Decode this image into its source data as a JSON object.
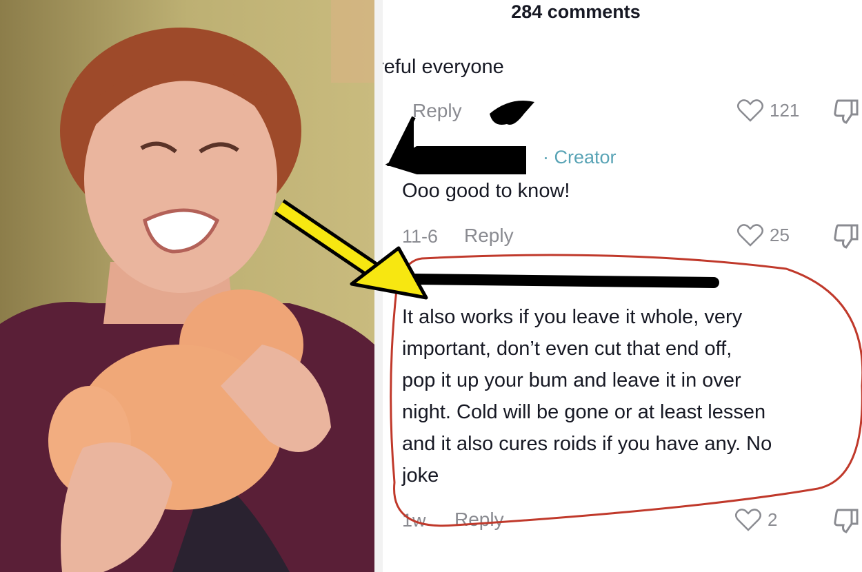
{
  "header": {
    "comment_count": "284 comments"
  },
  "comments": [
    {
      "text": "reful everyone",
      "reply_label": "Reply",
      "likes": "121"
    },
    {
      "author_badge": "· Creator",
      "text": "Ooo good to know!",
      "date": "11-6",
      "reply_label": "Reply",
      "likes": "25"
    },
    {
      "text_lines": [
        "It also works if you leave it whole, very",
        "important, don’t even cut that end off,",
        "pop it up your bum and leave it in over",
        "night. Cold will be gone or at least lessen",
        "and it also cures roids if you have any. No",
        "joke"
      ],
      "date": "1w",
      "reply_label": "Reply",
      "likes": "2"
    }
  ],
  "colors": {
    "arrow": "#f7e711",
    "circle": "#c0392b",
    "creator": "#58a3b5",
    "meta": "#8a8b91"
  },
  "icons": [
    "heart-icon",
    "dislike-icon",
    "arrow-icon"
  ]
}
